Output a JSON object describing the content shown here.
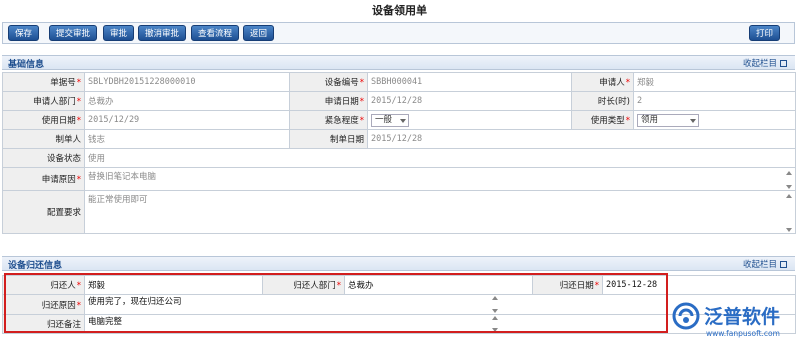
{
  "page": {
    "title": "设备领用单"
  },
  "toolbar": {
    "save": "保存",
    "submit": "提交审批",
    "approve": "审批",
    "cancel_approve": "撤消审批",
    "view_flow": "查看流程",
    "back": "返回",
    "print": "打印"
  },
  "basic": {
    "section_title": "基础信息",
    "collapse": "收起栏目",
    "order_no_label": "单据号",
    "order_no": "SBLYDBH20151228000010",
    "equip_no_label": "设备编号",
    "equip_no": "SBBH000041",
    "applicant_label": "申请人",
    "applicant": "郑毅",
    "dept_label": "申请人部门",
    "dept": "总裁办",
    "apply_date_label": "申请日期",
    "apply_date": "2015/12/28",
    "duration_label": "时长(时)",
    "duration": "2",
    "use_date_label": "使用日期",
    "use_date": "2015/12/29",
    "urgency_label": "紧急程度",
    "urgency": "一般",
    "use_type_label": "使用类型",
    "use_type": "领用",
    "creator_label": "制单人",
    "creator": "钱志",
    "create_date_label": "制单日期",
    "create_date": "2015/12/28",
    "status_label": "设备状态",
    "status": "使用",
    "reason_label": "申请原因",
    "reason": "替换旧笔记本电脑",
    "config_label": "配置要求",
    "config": "能正常使用即可"
  },
  "return": {
    "section_title": "设备归还信息",
    "collapse": "收起栏目",
    "returner_label": "归还人",
    "returner": "郑毅",
    "returner_dept_label": "归还人部门",
    "returner_dept": "总裁办",
    "return_date_label": "归还日期",
    "return_date": "2015-12-28",
    "return_reason_label": "归还原因",
    "return_reason": "使用完了，现在归还公司",
    "return_note_label": "归还备注",
    "return_note": "电脑完整"
  },
  "logo": {
    "name": "泛普软件",
    "url": "www.fanpusoft.com"
  },
  "colors": {
    "accent": "#1f4f8f",
    "button": "#2a5ea8",
    "highlight": "#d21e1e"
  }
}
